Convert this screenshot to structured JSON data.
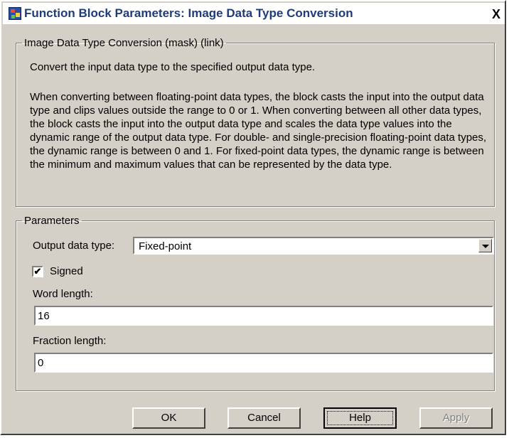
{
  "window": {
    "title": "Function Block Parameters: Image Data Type Conversion",
    "close_glyph": "X"
  },
  "description_group": {
    "legend": "Image Data Type Conversion (mask) (link)",
    "summary": "Convert the input data type to the specified output data type.",
    "text": "When converting between floating-point data types, the block casts the input into the output data type and clips values outside the range to 0 or 1. When converting between all other data types, the block casts the input into the output data type and scales the data type values into the dynamic range of the output data type. For double- and single-precision floating-point data types, the dynamic range is between 0 and 1. For fixed-point data types, the dynamic range is between the minimum and maximum values that can be represented by the data type."
  },
  "parameters": {
    "legend": "Parameters",
    "output_type_label": "Output data type:",
    "output_type_value": "Fixed-point",
    "signed_label": "Signed",
    "signed_checked": true,
    "check_glyph": "✔",
    "word_length_label": "Word length:",
    "word_length_value": "16",
    "fraction_length_label": "Fraction length:",
    "fraction_length_value": "0"
  },
  "buttons": {
    "ok": "OK",
    "cancel": "Cancel",
    "help": "Help",
    "apply": "Apply"
  },
  "icons": {
    "app": "simulink-block-icon",
    "close": "close-icon",
    "dropdown": "chevron-down-icon"
  }
}
